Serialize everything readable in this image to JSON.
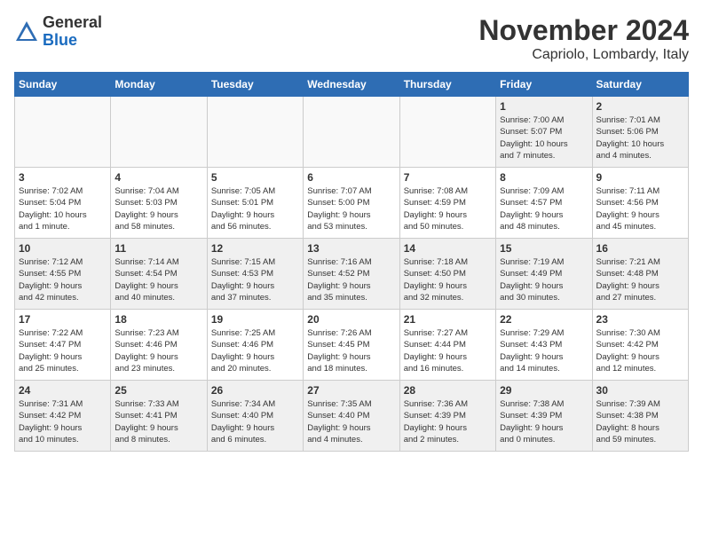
{
  "logo": {
    "general": "General",
    "blue": "Blue"
  },
  "header": {
    "month": "November 2024",
    "location": "Capriolo, Lombardy, Italy"
  },
  "weekdays": [
    "Sunday",
    "Monday",
    "Tuesday",
    "Wednesday",
    "Thursday",
    "Friday",
    "Saturday"
  ],
  "weeks": [
    [
      {
        "day": "",
        "info": ""
      },
      {
        "day": "",
        "info": ""
      },
      {
        "day": "",
        "info": ""
      },
      {
        "day": "",
        "info": ""
      },
      {
        "day": "",
        "info": ""
      },
      {
        "day": "1",
        "info": "Sunrise: 7:00 AM\nSunset: 5:07 PM\nDaylight: 10 hours\nand 7 minutes."
      },
      {
        "day": "2",
        "info": "Sunrise: 7:01 AM\nSunset: 5:06 PM\nDaylight: 10 hours\nand 4 minutes."
      }
    ],
    [
      {
        "day": "3",
        "info": "Sunrise: 7:02 AM\nSunset: 5:04 PM\nDaylight: 10 hours\nand 1 minute."
      },
      {
        "day": "4",
        "info": "Sunrise: 7:04 AM\nSunset: 5:03 PM\nDaylight: 9 hours\nand 58 minutes."
      },
      {
        "day": "5",
        "info": "Sunrise: 7:05 AM\nSunset: 5:01 PM\nDaylight: 9 hours\nand 56 minutes."
      },
      {
        "day": "6",
        "info": "Sunrise: 7:07 AM\nSunset: 5:00 PM\nDaylight: 9 hours\nand 53 minutes."
      },
      {
        "day": "7",
        "info": "Sunrise: 7:08 AM\nSunset: 4:59 PM\nDaylight: 9 hours\nand 50 minutes."
      },
      {
        "day": "8",
        "info": "Sunrise: 7:09 AM\nSunset: 4:57 PM\nDaylight: 9 hours\nand 48 minutes."
      },
      {
        "day": "9",
        "info": "Sunrise: 7:11 AM\nSunset: 4:56 PM\nDaylight: 9 hours\nand 45 minutes."
      }
    ],
    [
      {
        "day": "10",
        "info": "Sunrise: 7:12 AM\nSunset: 4:55 PM\nDaylight: 9 hours\nand 42 minutes."
      },
      {
        "day": "11",
        "info": "Sunrise: 7:14 AM\nSunset: 4:54 PM\nDaylight: 9 hours\nand 40 minutes."
      },
      {
        "day": "12",
        "info": "Sunrise: 7:15 AM\nSunset: 4:53 PM\nDaylight: 9 hours\nand 37 minutes."
      },
      {
        "day": "13",
        "info": "Sunrise: 7:16 AM\nSunset: 4:52 PM\nDaylight: 9 hours\nand 35 minutes."
      },
      {
        "day": "14",
        "info": "Sunrise: 7:18 AM\nSunset: 4:50 PM\nDaylight: 9 hours\nand 32 minutes."
      },
      {
        "day": "15",
        "info": "Sunrise: 7:19 AM\nSunset: 4:49 PM\nDaylight: 9 hours\nand 30 minutes."
      },
      {
        "day": "16",
        "info": "Sunrise: 7:21 AM\nSunset: 4:48 PM\nDaylight: 9 hours\nand 27 minutes."
      }
    ],
    [
      {
        "day": "17",
        "info": "Sunrise: 7:22 AM\nSunset: 4:47 PM\nDaylight: 9 hours\nand 25 minutes."
      },
      {
        "day": "18",
        "info": "Sunrise: 7:23 AM\nSunset: 4:46 PM\nDaylight: 9 hours\nand 23 minutes."
      },
      {
        "day": "19",
        "info": "Sunrise: 7:25 AM\nSunset: 4:46 PM\nDaylight: 9 hours\nand 20 minutes."
      },
      {
        "day": "20",
        "info": "Sunrise: 7:26 AM\nSunset: 4:45 PM\nDaylight: 9 hours\nand 18 minutes."
      },
      {
        "day": "21",
        "info": "Sunrise: 7:27 AM\nSunset: 4:44 PM\nDaylight: 9 hours\nand 16 minutes."
      },
      {
        "day": "22",
        "info": "Sunrise: 7:29 AM\nSunset: 4:43 PM\nDaylight: 9 hours\nand 14 minutes."
      },
      {
        "day": "23",
        "info": "Sunrise: 7:30 AM\nSunset: 4:42 PM\nDaylight: 9 hours\nand 12 minutes."
      }
    ],
    [
      {
        "day": "24",
        "info": "Sunrise: 7:31 AM\nSunset: 4:42 PM\nDaylight: 9 hours\nand 10 minutes."
      },
      {
        "day": "25",
        "info": "Sunrise: 7:33 AM\nSunset: 4:41 PM\nDaylight: 9 hours\nand 8 minutes."
      },
      {
        "day": "26",
        "info": "Sunrise: 7:34 AM\nSunset: 4:40 PM\nDaylight: 9 hours\nand 6 minutes."
      },
      {
        "day": "27",
        "info": "Sunrise: 7:35 AM\nSunset: 4:40 PM\nDaylight: 9 hours\nand 4 minutes."
      },
      {
        "day": "28",
        "info": "Sunrise: 7:36 AM\nSunset: 4:39 PM\nDaylight: 9 hours\nand 2 minutes."
      },
      {
        "day": "29",
        "info": "Sunrise: 7:38 AM\nSunset: 4:39 PM\nDaylight: 9 hours\nand 0 minutes."
      },
      {
        "day": "30",
        "info": "Sunrise: 7:39 AM\nSunset: 4:38 PM\nDaylight: 8 hours\nand 59 minutes."
      }
    ]
  ]
}
